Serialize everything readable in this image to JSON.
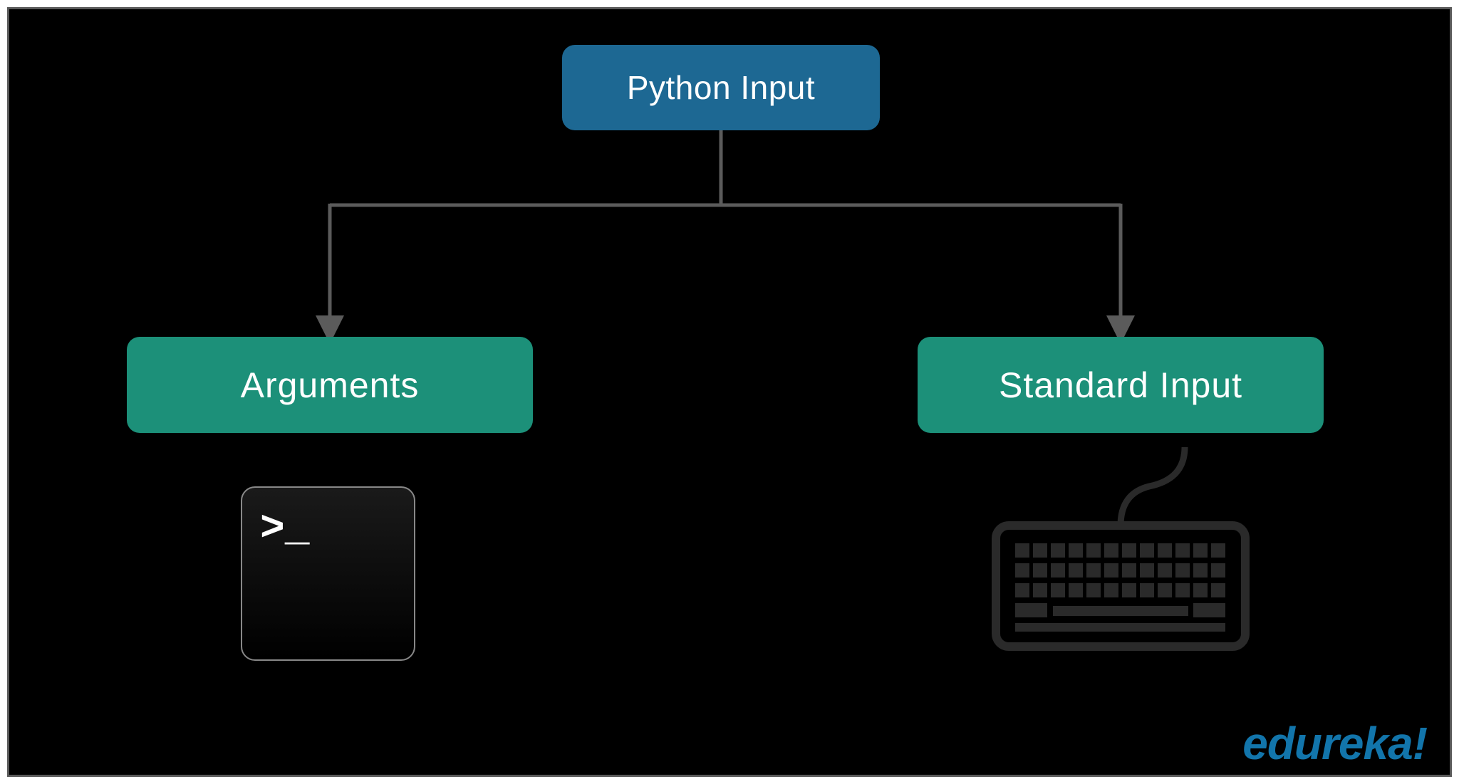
{
  "diagram": {
    "root": {
      "label": "Python Input"
    },
    "children": [
      {
        "label": "Arguments",
        "icon": "terminal"
      },
      {
        "label": "Standard Input",
        "icon": "keyboard"
      }
    ]
  },
  "icons": {
    "terminal_prompt": ">_"
  },
  "brand": "edureka!",
  "colors": {
    "root_bg": "#1d6893",
    "child_bg": "#1c9079",
    "text": "#ffffff",
    "connector": "#5b5b5b",
    "brand": "#1275ab",
    "frame_border": "#5a5a5a",
    "frame_bg": "#000000"
  }
}
